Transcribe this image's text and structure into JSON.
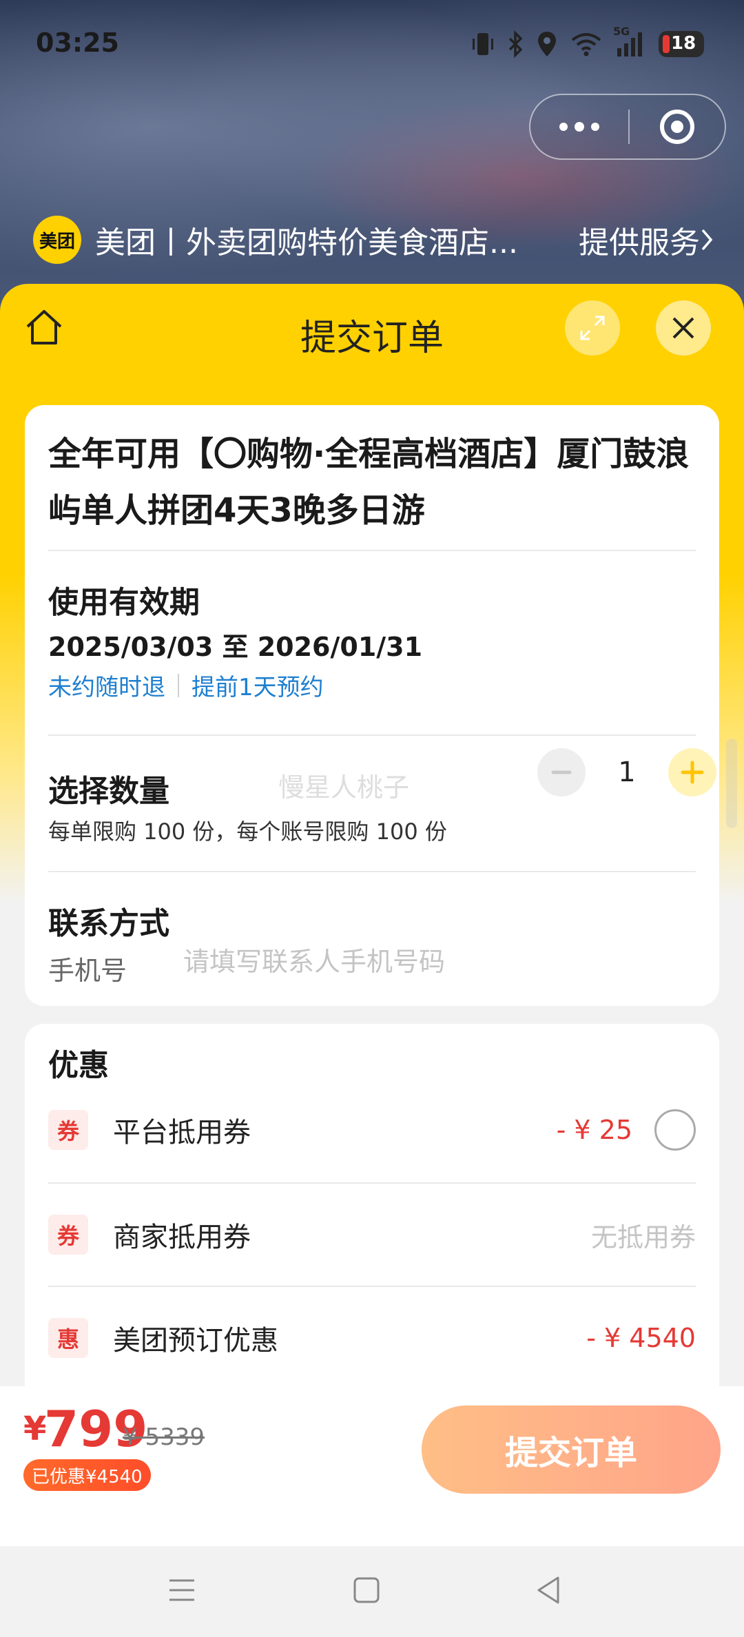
{
  "status_bar": {
    "time": "03:25",
    "network": "5G",
    "battery": "18",
    "icons": [
      "vibrate-icon",
      "bluetooth-icon",
      "location-icon",
      "wifi-icon",
      "signal-icon",
      "battery-icon"
    ]
  },
  "miniprogram": {
    "logo_text": "美团",
    "title": "美团丨外卖团购特价美食酒店...",
    "service_label": "提供服务"
  },
  "sheet": {
    "title": "提交订单"
  },
  "product": {
    "title": "全年可用【〇购物·全程高档酒店】厦门鼓浪屿单人拼团4天3晚多日游"
  },
  "validity": {
    "heading": "使用有效期",
    "dates": "2025/03/03 至 2026/01/31",
    "tags": [
      "未约随时退",
      "提前1天预约"
    ]
  },
  "quantity": {
    "heading": "选择数量",
    "value": "1",
    "limit": "每单限购 100 份，每个账号限购 100 份",
    "watermark": "慢星人桃子"
  },
  "contact": {
    "heading": "联系方式",
    "phone_label": "手机号",
    "phone_placeholder": "请填写联系人手机号码",
    "phone_value": ""
  },
  "discounts": {
    "heading": "优惠",
    "items": [
      {
        "badge": "券",
        "label": "平台抵用券",
        "amount": "- ¥ 25"
      },
      {
        "badge": "券",
        "label": "商家抵用券",
        "amount": "无抵用券"
      },
      {
        "badge": "惠",
        "label": "美团预订优惠",
        "amount": "- ¥ 4540"
      }
    ]
  },
  "checkout": {
    "currency": "¥",
    "price": "799",
    "original_price": "¥ 5339",
    "saved": "已优惠¥4540",
    "submit_label": "提交订单"
  },
  "colors": {
    "brand_yellow": "#ffd100",
    "price_red": "#e53935",
    "link_blue": "#1e7fd0",
    "submit_orange": "#ffb086"
  }
}
